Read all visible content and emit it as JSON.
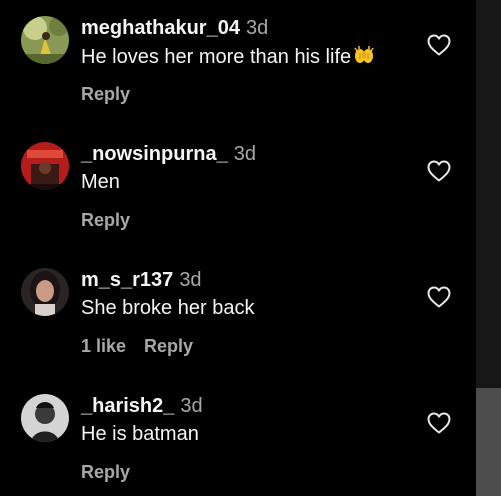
{
  "comments": [
    {
      "username": "meghathakur_04",
      "time": "3d",
      "text": "He loves her more than his life",
      "emoji": "raising-hands-emoji",
      "actions": {
        "reply": "Reply"
      }
    },
    {
      "username": "_nowsinpurna_",
      "time": "3d",
      "text": "Men",
      "actions": {
        "reply": "Reply"
      }
    },
    {
      "username": "m_s_r137",
      "time": "3d",
      "text": "She broke her back",
      "actions": {
        "likes": "1 like",
        "reply": "Reply"
      }
    },
    {
      "username": "_harish2_",
      "time": "3d",
      "text": "He is batman",
      "actions": {
        "reply": "Reply"
      }
    }
  ],
  "icons": {
    "like": "heart-outline-icon"
  },
  "colors": {
    "background": "#000000",
    "text": "#f5f5f5",
    "muted": "#a8a8a8",
    "scrollbar_track": "#171717",
    "scrollbar_thumb": "#4d4d4d"
  }
}
